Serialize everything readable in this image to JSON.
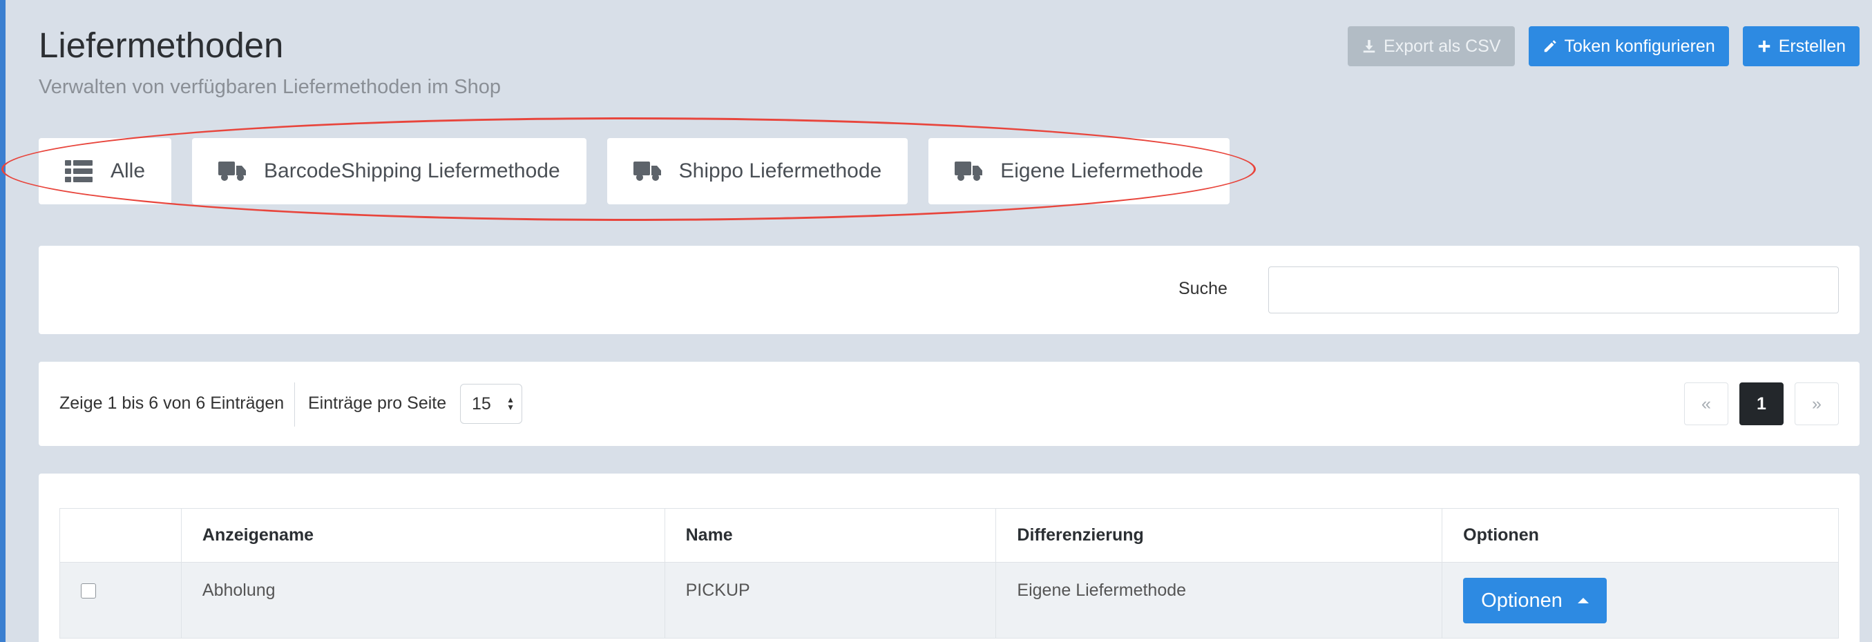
{
  "header": {
    "title": "Liefermethoden",
    "subtitle": "Verwalten von verfügbaren Liefermethoden im Shop"
  },
  "actions": {
    "export_label": "Export als CSV",
    "token_label": "Token konfigurieren",
    "create_label": "Erstellen"
  },
  "tabs": [
    {
      "label": "Alle",
      "icon": "list-icon"
    },
    {
      "label": "BarcodeShipping Liefermethode",
      "icon": "truck-icon"
    },
    {
      "label": "Shippo Liefermethode",
      "icon": "truck-icon"
    },
    {
      "label": "Eigene Liefermethode",
      "icon": "truck-icon"
    }
  ],
  "search": {
    "label": "Suche",
    "value": ""
  },
  "listing": {
    "info": "Zeige 1 bis 6 von 6 Einträgen",
    "per_page_label": "Einträge pro Seite",
    "per_page_value": "15",
    "pager": {
      "prev": "«",
      "current": "1",
      "next": "»"
    }
  },
  "table": {
    "columns": [
      "",
      "Anzeigename",
      "Name",
      "Differenzierung",
      "Optionen"
    ],
    "rows": [
      {
        "anzeigename": "Abholung",
        "name": "PICKUP",
        "differenzierung": "Eigene Liefermethode",
        "options_label": "Optionen"
      }
    ]
  },
  "colors": {
    "accent": "#2d8ae2",
    "background": "#d8dfe8",
    "highlight": "#e8453c"
  }
}
